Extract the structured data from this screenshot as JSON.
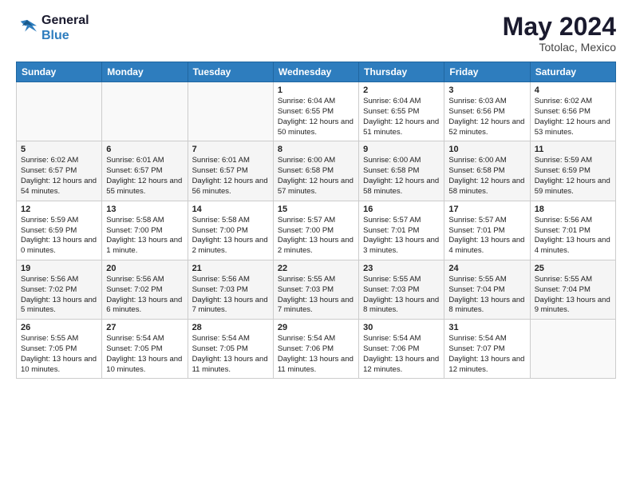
{
  "header": {
    "logo_line1": "General",
    "logo_line2": "Blue",
    "title": "May 2024",
    "subtitle": "Totolac, Mexico"
  },
  "weekdays": [
    "Sunday",
    "Monday",
    "Tuesday",
    "Wednesday",
    "Thursday",
    "Friday",
    "Saturday"
  ],
  "weeks": [
    [
      {
        "day": "",
        "empty": true
      },
      {
        "day": "",
        "empty": true
      },
      {
        "day": "",
        "empty": true
      },
      {
        "day": "1",
        "rise": "6:04 AM",
        "set": "6:55 PM",
        "hours": "12 hours and 50 minutes."
      },
      {
        "day": "2",
        "rise": "6:04 AM",
        "set": "6:55 PM",
        "hours": "12 hours and 51 minutes."
      },
      {
        "day": "3",
        "rise": "6:03 AM",
        "set": "6:56 PM",
        "hours": "12 hours and 52 minutes."
      },
      {
        "day": "4",
        "rise": "6:02 AM",
        "set": "6:56 PM",
        "hours": "12 hours and 53 minutes."
      }
    ],
    [
      {
        "day": "5",
        "rise": "6:02 AM",
        "set": "6:57 PM",
        "hours": "12 hours and 54 minutes."
      },
      {
        "day": "6",
        "rise": "6:01 AM",
        "set": "6:57 PM",
        "hours": "12 hours and 55 minutes."
      },
      {
        "day": "7",
        "rise": "6:01 AM",
        "set": "6:57 PM",
        "hours": "12 hours and 56 minutes."
      },
      {
        "day": "8",
        "rise": "6:00 AM",
        "set": "6:58 PM",
        "hours": "12 hours and 57 minutes."
      },
      {
        "day": "9",
        "rise": "6:00 AM",
        "set": "6:58 PM",
        "hours": "12 hours and 58 minutes."
      },
      {
        "day": "10",
        "rise": "6:00 AM",
        "set": "6:58 PM",
        "hours": "12 hours and 58 minutes."
      },
      {
        "day": "11",
        "rise": "5:59 AM",
        "set": "6:59 PM",
        "hours": "12 hours and 59 minutes."
      }
    ],
    [
      {
        "day": "12",
        "rise": "5:59 AM",
        "set": "6:59 PM",
        "hours": "13 hours and 0 minutes."
      },
      {
        "day": "13",
        "rise": "5:58 AM",
        "set": "7:00 PM",
        "hours": "13 hours and 1 minute."
      },
      {
        "day": "14",
        "rise": "5:58 AM",
        "set": "7:00 PM",
        "hours": "13 hours and 2 minutes."
      },
      {
        "day": "15",
        "rise": "5:57 AM",
        "set": "7:00 PM",
        "hours": "13 hours and 2 minutes."
      },
      {
        "day": "16",
        "rise": "5:57 AM",
        "set": "7:01 PM",
        "hours": "13 hours and 3 minutes."
      },
      {
        "day": "17",
        "rise": "5:57 AM",
        "set": "7:01 PM",
        "hours": "13 hours and 4 minutes."
      },
      {
        "day": "18",
        "rise": "5:56 AM",
        "set": "7:01 PM",
        "hours": "13 hours and 4 minutes."
      }
    ],
    [
      {
        "day": "19",
        "rise": "5:56 AM",
        "set": "7:02 PM",
        "hours": "13 hours and 5 minutes."
      },
      {
        "day": "20",
        "rise": "5:56 AM",
        "set": "7:02 PM",
        "hours": "13 hours and 6 minutes."
      },
      {
        "day": "21",
        "rise": "5:56 AM",
        "set": "7:03 PM",
        "hours": "13 hours and 7 minutes."
      },
      {
        "day": "22",
        "rise": "5:55 AM",
        "set": "7:03 PM",
        "hours": "13 hours and 7 minutes."
      },
      {
        "day": "23",
        "rise": "5:55 AM",
        "set": "7:03 PM",
        "hours": "13 hours and 8 minutes."
      },
      {
        "day": "24",
        "rise": "5:55 AM",
        "set": "7:04 PM",
        "hours": "13 hours and 8 minutes."
      },
      {
        "day": "25",
        "rise": "5:55 AM",
        "set": "7:04 PM",
        "hours": "13 hours and 9 minutes."
      }
    ],
    [
      {
        "day": "26",
        "rise": "5:55 AM",
        "set": "7:05 PM",
        "hours": "13 hours and 10 minutes."
      },
      {
        "day": "27",
        "rise": "5:54 AM",
        "set": "7:05 PM",
        "hours": "13 hours and 10 minutes."
      },
      {
        "day": "28",
        "rise": "5:54 AM",
        "set": "7:05 PM",
        "hours": "13 hours and 11 minutes."
      },
      {
        "day": "29",
        "rise": "5:54 AM",
        "set": "7:06 PM",
        "hours": "13 hours and 11 minutes."
      },
      {
        "day": "30",
        "rise": "5:54 AM",
        "set": "7:06 PM",
        "hours": "13 hours and 12 minutes."
      },
      {
        "day": "31",
        "rise": "5:54 AM",
        "set": "7:07 PM",
        "hours": "13 hours and 12 minutes."
      },
      {
        "day": "",
        "empty": true
      }
    ]
  ],
  "labels": {
    "sunrise": "Sunrise:",
    "sunset": "Sunset:",
    "daylight": "Daylight:"
  }
}
